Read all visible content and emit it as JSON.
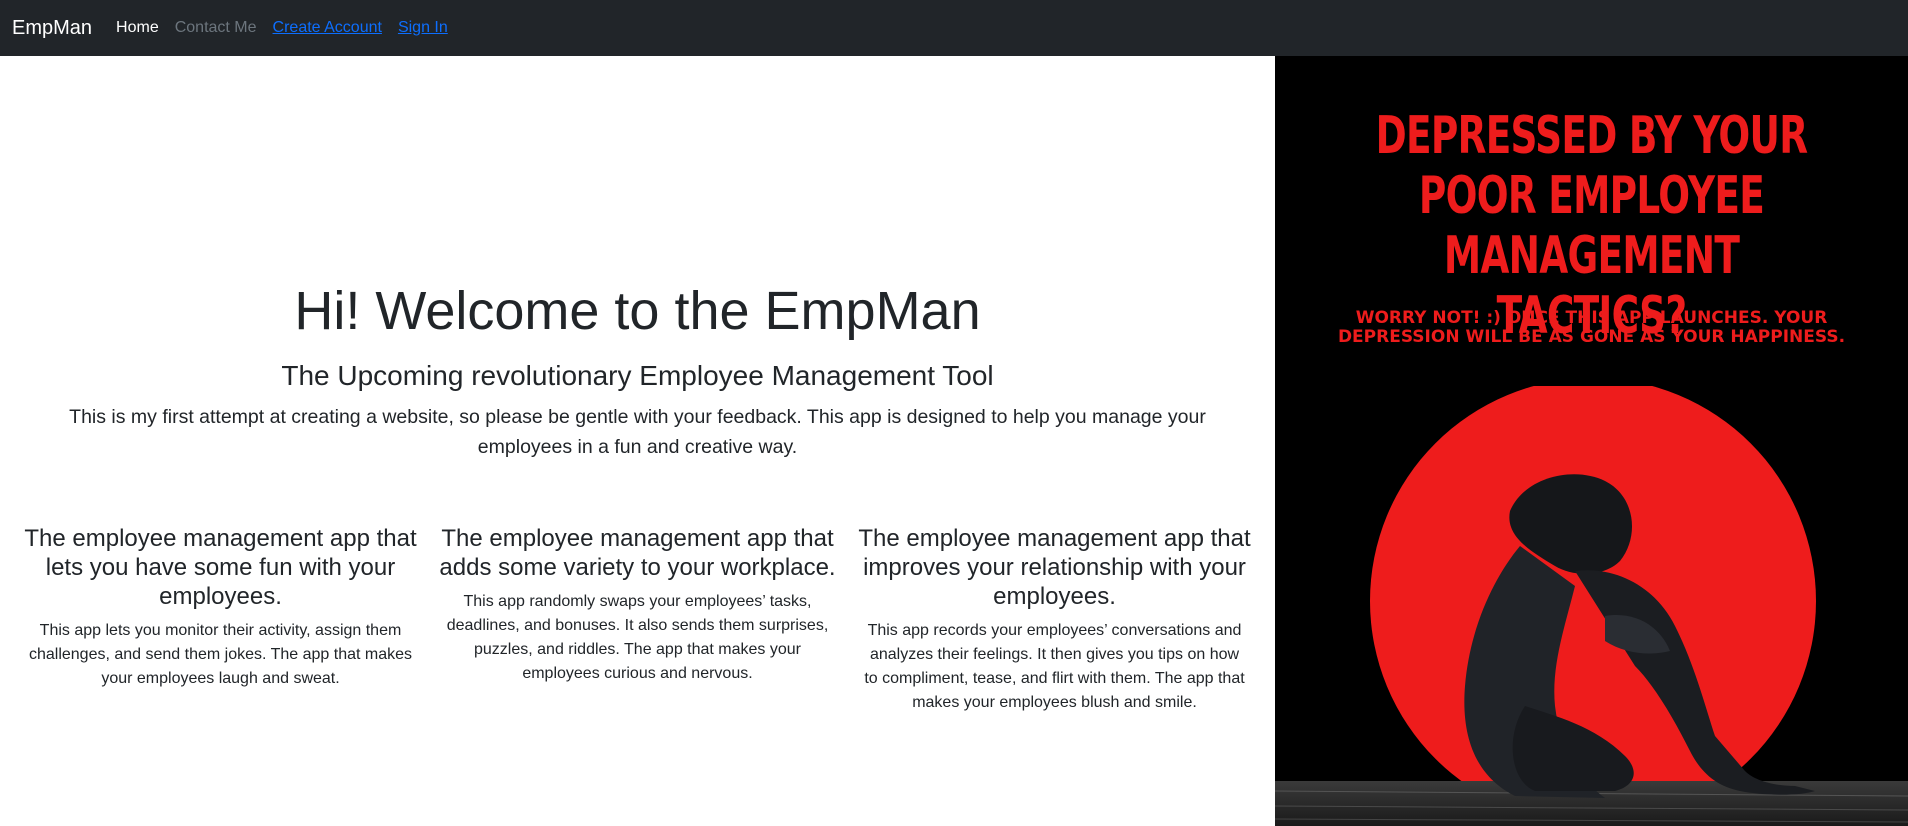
{
  "navbar": {
    "brand": "EmpMan",
    "links": [
      {
        "label": "Home"
      },
      {
        "label": "Contact Me"
      },
      {
        "label": "Create Account"
      },
      {
        "label": "Sign In"
      }
    ]
  },
  "hero": {
    "title": "Hi! Welcome to the EmpMan",
    "subtitle": "The Upcoming revolutionary Employee Management Tool",
    "text": "This is my first attempt at creating a website, so please be gentle with your feedback. This app is designed to help you manage your employees in a fun and creative way."
  },
  "features": [
    {
      "heading": "The employee management app that lets you have some fun with your employees.",
      "body": "This app lets you monitor their activity, assign them challenges, and send them jokes. The app that makes your employees laugh and sweat."
    },
    {
      "heading": "The employee management app that adds some variety to your workplace.",
      "body": "This app randomly swaps your employees’ tasks, deadlines, and bonuses. It also sends them surprises, puzzles, and riddles. The app that makes your employees curious and nervous."
    },
    {
      "heading": "The employee management app that improves your relationship with your employees.",
      "body": "This app records your employees’ conversations and analyzes their feelings. It then gives you tips on how to compliment, tease, and flirt with them. The app that makes your employees blush and smile."
    }
  ],
  "poster": {
    "headline": "DEPRESSED BY YOUR POOR EMPLOYEE MANAGEMENT TACTICS?",
    "subline": "WORRY NOT! :) ONCE THIS APP LAUNCHES. YOUR DEPRESSION WILL BE AS GONE AS YOUR HAPPINESS.",
    "colors": {
      "background": "#000000",
      "accent": "#ee1c1c"
    }
  }
}
